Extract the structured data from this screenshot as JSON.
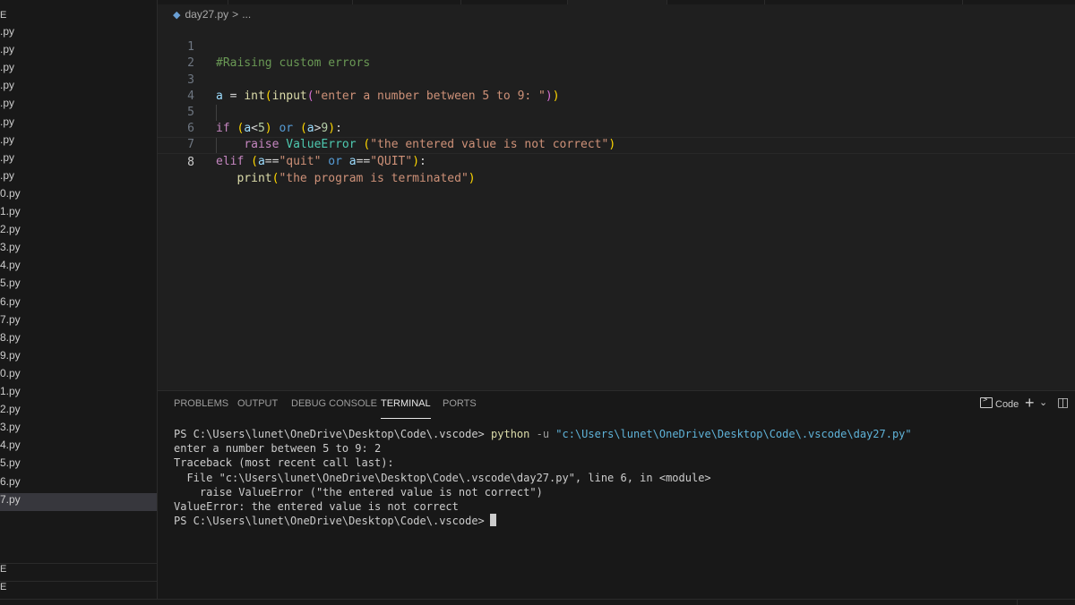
{
  "explorer": {
    "header": "E",
    "files": [
      ".py",
      ".py",
      ".py",
      ".py",
      ".py",
      ".py",
      ".py",
      ".py",
      ".py",
      "0.py",
      "1.py",
      "2.py",
      "3.py",
      "4.py",
      "5.py",
      "6.py",
      "7.py",
      "8.py",
      "9.py",
      "0.py",
      "1.py",
      "2.py",
      "3.py",
      "4.py",
      "5.py",
      "6.py",
      "7.py"
    ],
    "active_index": 26,
    "sections": [
      "E",
      "E"
    ]
  },
  "breadcrumb": {
    "file": "day27.py",
    "separator": ">",
    "more": "..."
  },
  "editor": {
    "lines": [
      {
        "n": "1"
      },
      {
        "n": "2"
      },
      {
        "n": "3"
      },
      {
        "n": "4"
      },
      {
        "n": "5"
      },
      {
        "n": "6"
      },
      {
        "n": "7"
      },
      {
        "n": "8"
      }
    ],
    "current_line": "8",
    "code": {
      "l1_comment": "#Raising custom errors",
      "l3_var": "a",
      "l3_eq": " = ",
      "l3_fn1": "int",
      "l3_p1": "(",
      "l3_fn2": "input",
      "l3_p2": "(",
      "l3_str": "\"enter a number between 5 to 9: \"",
      "l3_p3": ")",
      "l3_p4": ")",
      "l5_kw": "if",
      "l5_p1": "(",
      "l5_var1": "a",
      "l5_op1": "<",
      "l5_num1": "5",
      "l5_p2": ")",
      "l5_or": "or",
      "l5_p3": "(",
      "l5_var2": "a",
      "l5_op2": ">",
      "l5_num2": "9",
      "l5_p4": ")",
      "l5_colon": ":",
      "l6_kw": "raise",
      "l6_cls": "ValueError",
      "l6_p1": "(",
      "l6_str": "\"the entered value is not correct\"",
      "l6_p2": ")",
      "l7_kw": "elif",
      "l7_p1": "(",
      "l7_var1": "a",
      "l7_eq1": "==",
      "l7_str1": "\"quit\"",
      "l7_or": "or",
      "l7_var2": "a",
      "l7_eq2": "==",
      "l7_str2": "\"QUIT\"",
      "l7_p2": ")",
      "l7_colon": ":",
      "l8_fn": "print",
      "l8_p1": "(",
      "l8_str": "\"the program is terminated\"",
      "l8_p2": ")"
    }
  },
  "panel": {
    "tabs": [
      {
        "label": "PROBLEMS"
      },
      {
        "label": "OUTPUT"
      },
      {
        "label": "DEBUG CONSOLE"
      },
      {
        "label": "TERMINAL"
      },
      {
        "label": "PORTS"
      }
    ],
    "active_tab": "TERMINAL",
    "terminal_name": "Code",
    "add_label": "+",
    "chevron": "⌄",
    "layout_icon": "◫",
    "terminal": {
      "prompt1": "PS C:\\Users\\lunet\\OneDrive\\Desktop\\Code\\.vscode> ",
      "cmd": "python",
      "flag": " -u ",
      "path": "\"c:\\Users\\lunet\\OneDrive\\Desktop\\Code\\.vscode\\day27.py\"",
      "out1": "enter a number between 5 to 9: 2",
      "out2": "Traceback (most recent call last):",
      "out3": "  File \"c:\\Users\\lunet\\OneDrive\\Desktop\\Code\\.vscode\\day27.py\", line 6, in <module>",
      "out4": "    raise ValueError (\"the entered value is not correct\")",
      "out5": "ValueError: the entered value is not correct",
      "prompt2": "PS C:\\Users\\lunet\\OneDrive\\Desktop\\Code\\.vscode>"
    }
  }
}
